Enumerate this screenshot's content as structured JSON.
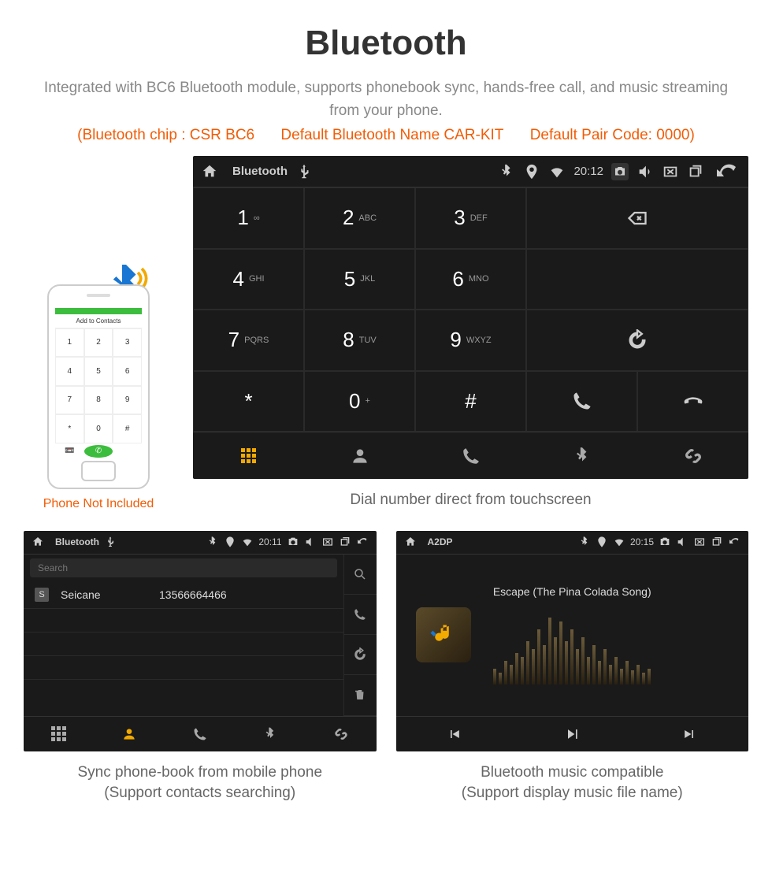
{
  "title": "Bluetooth",
  "subtitle": "Integrated with BC6 Bluetooth module, supports phonebook sync, hands-free call, and music streaming from your phone.",
  "specs": {
    "chip": "(Bluetooth chip : CSR BC6",
    "name": "Default Bluetooth Name CAR-KIT",
    "code": "Default Pair Code: 0000)"
  },
  "phone": {
    "caption": "Phone Not Included",
    "add_label": "Add to Contacts",
    "keys": [
      "1",
      "2",
      "3",
      "4",
      "5",
      "6",
      "7",
      "8",
      "9",
      "*",
      "0",
      "#"
    ]
  },
  "dialer": {
    "status_title": "Bluetooth",
    "time": "20:12",
    "keys": [
      {
        "n": "1",
        "s": "∞"
      },
      {
        "n": "2",
        "s": "ABC"
      },
      {
        "n": "3",
        "s": "DEF"
      },
      {
        "n": "4",
        "s": "GHI"
      },
      {
        "n": "5",
        "s": "JKL"
      },
      {
        "n": "6",
        "s": "MNO"
      },
      {
        "n": "7",
        "s": "PQRS"
      },
      {
        "n": "8",
        "s": "TUV"
      },
      {
        "n": "9",
        "s": "WXYZ"
      },
      {
        "n": "*",
        "s": ""
      },
      {
        "n": "0",
        "s": "+"
      },
      {
        "n": "#",
        "s": ""
      }
    ],
    "caption": "Dial number direct from touchscreen"
  },
  "contacts": {
    "status_title": "Bluetooth",
    "time": "20:11",
    "search_placeholder": "Search",
    "list": [
      {
        "badge": "S",
        "name": "Seicane",
        "number": "13566664466"
      }
    ],
    "caption_l1": "Sync phone-book from mobile phone",
    "caption_l2": "(Support contacts searching)"
  },
  "music": {
    "status_title": "A2DP",
    "time": "20:15",
    "song": "Escape (The Pina Colada Song)",
    "caption_l1": "Bluetooth music compatible",
    "caption_l2": "(Support display music file name)",
    "eq_heights": [
      20,
      15,
      30,
      25,
      40,
      35,
      55,
      45,
      70,
      50,
      85,
      60,
      80,
      55,
      70,
      45,
      60,
      35,
      50,
      30,
      45,
      25,
      35,
      20,
      30,
      18,
      25,
      15,
      20
    ]
  }
}
